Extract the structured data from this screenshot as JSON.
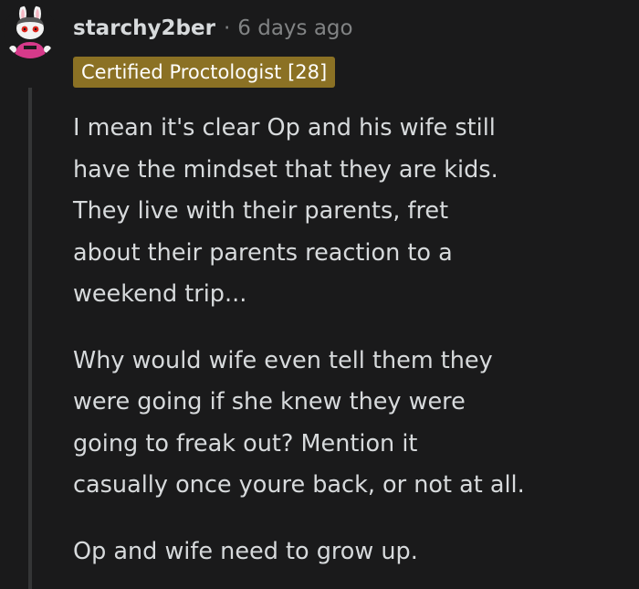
{
  "comment": {
    "username": "starchy2ber",
    "separator": "·",
    "timestamp": "6 days ago",
    "flair": "Certified Proctologist [28]",
    "avatar": "snoo-bunny-avatar-icon",
    "paragraphs": [
      [
        "I mean it's clear Op and his wife still",
        "have the mindset that they are kids.",
        "They live with their parents, fret",
        "about their parents reaction to a",
        "weekend trip..."
      ],
      [
        "Why would wife even tell them they",
        "were going if she knew they were",
        "going to freak out? Mention it",
        "casually once youre back, or not at all."
      ],
      [
        "Op and wife need to grow up."
      ]
    ]
  },
  "colors": {
    "background": "#1a1a1b",
    "text": "#d7dadc",
    "meta": "#818384",
    "flair_bg": "#8b7124",
    "thread_line": "#343536"
  }
}
